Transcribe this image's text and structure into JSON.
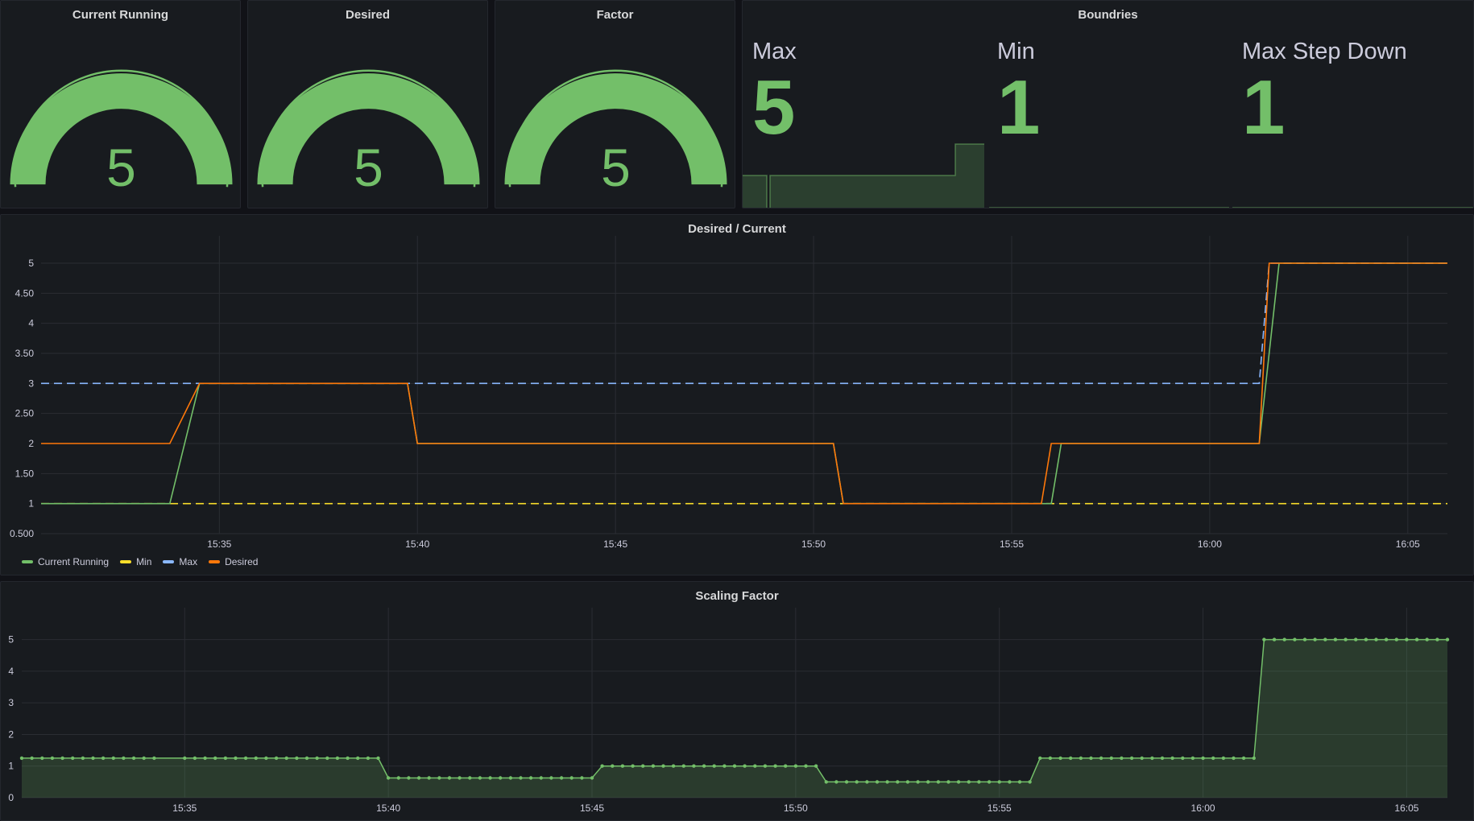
{
  "colors": {
    "green": "#73bf69",
    "yellow": "#fade2a",
    "blue": "#8ab8ff",
    "orange": "#ff780a",
    "text": "#ccccdc"
  },
  "gauges": [
    {
      "title": "Current Running",
      "value": "5",
      "fraction": 1.0
    },
    {
      "title": "Desired",
      "value": "5",
      "fraction": 1.0
    },
    {
      "title": "Factor",
      "value": "5",
      "fraction": 1.0
    }
  ],
  "boundries": {
    "title": "Boundries",
    "stats": [
      {
        "label": "Max",
        "value": "5"
      },
      {
        "label": "Min",
        "value": "1"
      },
      {
        "label": "Max Step Down",
        "value": "1"
      }
    ]
  },
  "chart_data": [
    {
      "type": "line",
      "title": "Desired / Current",
      "x_ticks": [
        "15:35",
        "15:40",
        "15:45",
        "15:50",
        "15:55",
        "16:00",
        "16:05"
      ],
      "y_ticks": [
        "5",
        "4.50",
        "4",
        "3.50",
        "3",
        "2.50",
        "2",
        "1.50",
        "1",
        "0.500"
      ],
      "ylim": [
        0.5,
        5
      ],
      "xlim": [
        "15:30:30",
        "16:06:00"
      ],
      "legend": "bottom-left",
      "grid": true,
      "series": [
        {
          "name": "Current Running",
          "color": "#73bf69",
          "style": "solid",
          "points": [
            [
              "15:30:30",
              1
            ],
            [
              "15:33:45",
              1
            ],
            [
              "15:34:30",
              3
            ],
            [
              "15:39:45",
              3
            ],
            [
              "15:40:00",
              2
            ],
            [
              "15:50:30",
              2
            ],
            [
              "15:50:45",
              1
            ],
            [
              "15:56:00",
              1
            ],
            [
              "15:56:15",
              2
            ],
            [
              "16:01:15",
              2
            ],
            [
              "16:01:45",
              5
            ],
            [
              "16:06:00",
              5
            ]
          ]
        },
        {
          "name": "Min",
          "color": "#fade2a",
          "style": "dashed",
          "points": [
            [
              "15:30:30",
              1
            ],
            [
              "16:06:00",
              1
            ]
          ]
        },
        {
          "name": "Max",
          "color": "#8ab8ff",
          "style": "dashed",
          "points": [
            [
              "15:30:30",
              3
            ],
            [
              "16:01:15",
              3
            ],
            [
              "16:01:30",
              5
            ],
            [
              "16:06:00",
              5
            ]
          ]
        },
        {
          "name": "Desired",
          "color": "#ff780a",
          "style": "solid",
          "points": [
            [
              "15:30:30",
              2
            ],
            [
              "15:33:45",
              2
            ],
            [
              "15:34:30",
              3
            ],
            [
              "15:39:45",
              3
            ],
            [
              "15:40:00",
              2
            ],
            [
              "15:50:30",
              2
            ],
            [
              "15:50:45",
              1
            ],
            [
              "15:55:45",
              1
            ],
            [
              "15:56:00",
              2
            ],
            [
              "16:01:15",
              2
            ],
            [
              "16:01:30",
              5
            ],
            [
              "16:06:00",
              5
            ]
          ]
        }
      ]
    },
    {
      "type": "area",
      "title": "Scaling Factor",
      "x_ticks": [
        "15:35",
        "15:40",
        "15:45",
        "15:50",
        "15:55",
        "16:00",
        "16:05"
      ],
      "y_ticks": [
        "5",
        "4",
        "3",
        "2",
        "1",
        "0"
      ],
      "ylim": [
        0,
        5.5
      ],
      "xlim": [
        "15:31:00",
        "16:06:00"
      ],
      "grid": true,
      "color": "#73bf69",
      "segments": [
        {
          "start": "15:31:00",
          "end": "15:34:15",
          "value": 1.25
        },
        {
          "start": "15:35:00",
          "end": "15:39:45",
          "value": 1.25
        },
        {
          "start": "15:40:00",
          "end": "15:45:00",
          "value": 0.625
        },
        {
          "start": "15:45:15",
          "end": "15:50:30",
          "value": 1.0
        },
        {
          "start": "15:50:45",
          "end": "15:55:45",
          "value": 0.5
        },
        {
          "start": "15:56:00",
          "end": "16:01:15",
          "value": 1.25
        },
        {
          "start": "16:01:30",
          "end": "16:06:00",
          "value": 5.0
        }
      ]
    }
  ]
}
